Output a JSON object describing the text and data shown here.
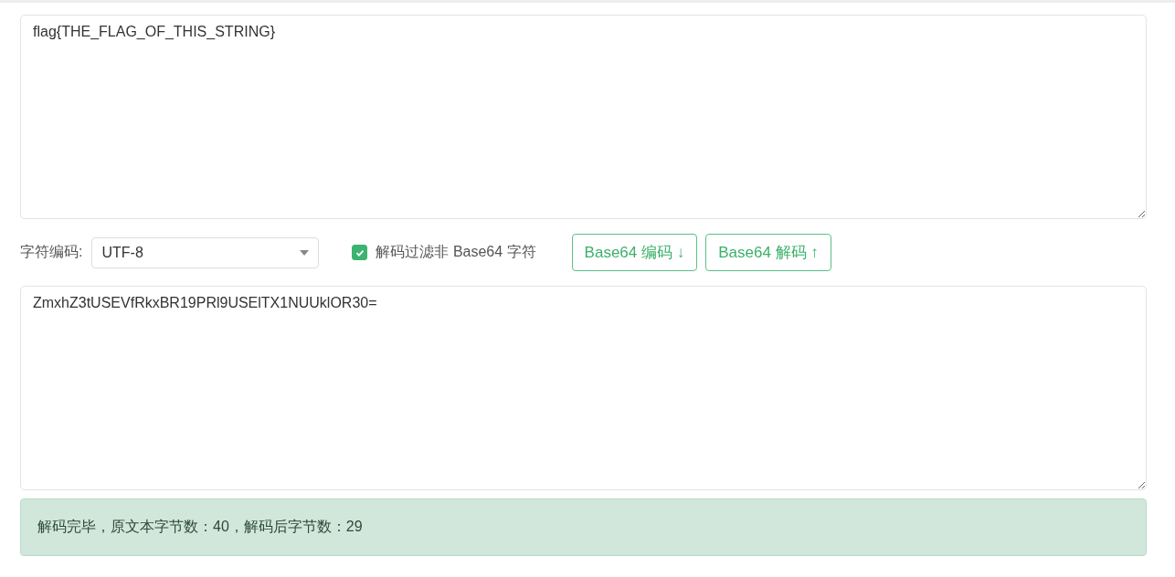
{
  "input_text": {
    "value": "flag{THE_FLAG_OF_THIS_STRING}"
  },
  "options": {
    "charset_label": "字符编码:",
    "charset_value": "UTF-8",
    "filter": {
      "label": "解码过滤非 Base64 字符",
      "checked": true
    },
    "buttons": [
      "Base64 编码 ↓",
      "Base64 解码 ↑"
    ]
  },
  "output_text": {
    "value": "ZmxhZ3tUSEVfRkxBR19PRl9USElTX1NUUklOR30="
  },
  "status": {
    "message": "解码完毕，原文本字节数：40，解码后字节数：29"
  }
}
